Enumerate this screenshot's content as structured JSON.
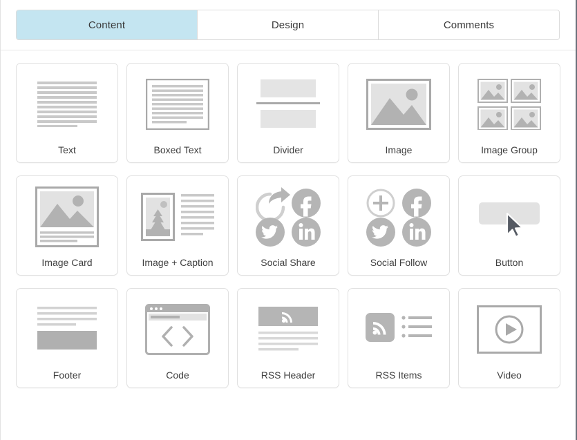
{
  "tabs": [
    {
      "label": "Content",
      "active": true
    },
    {
      "label": "Design",
      "active": false
    },
    {
      "label": "Comments",
      "active": false
    }
  ],
  "colors": {
    "active_tab_bg": "#c4e5f1",
    "tile_border": "#e0e0e0",
    "label_text": "#3f3f3f",
    "art_light": "#e2e2e2",
    "art_mid": "#b8b8b8",
    "art_dark": "#a8a8a8"
  },
  "blocks": [
    {
      "label": "Text",
      "icon": "text-lines-icon"
    },
    {
      "label": "Boxed Text",
      "icon": "boxed-text-icon"
    },
    {
      "label": "Divider",
      "icon": "divider-icon"
    },
    {
      "label": "Image",
      "icon": "image-icon"
    },
    {
      "label": "Image Group",
      "icon": "image-group-icon"
    },
    {
      "label": "Image Card",
      "icon": "image-card-icon"
    },
    {
      "label": "Image + Caption",
      "icon": "image-caption-icon"
    },
    {
      "label": "Social Share",
      "icon": "social-share-icon"
    },
    {
      "label": "Social Follow",
      "icon": "social-follow-icon"
    },
    {
      "label": "Button",
      "icon": "button-cursor-icon"
    },
    {
      "label": "Footer",
      "icon": "footer-icon"
    },
    {
      "label": "Code",
      "icon": "code-window-icon"
    },
    {
      "label": "RSS Header",
      "icon": "rss-header-icon"
    },
    {
      "label": "RSS Items",
      "icon": "rss-items-icon"
    },
    {
      "label": "Video",
      "icon": "video-play-icon"
    }
  ]
}
